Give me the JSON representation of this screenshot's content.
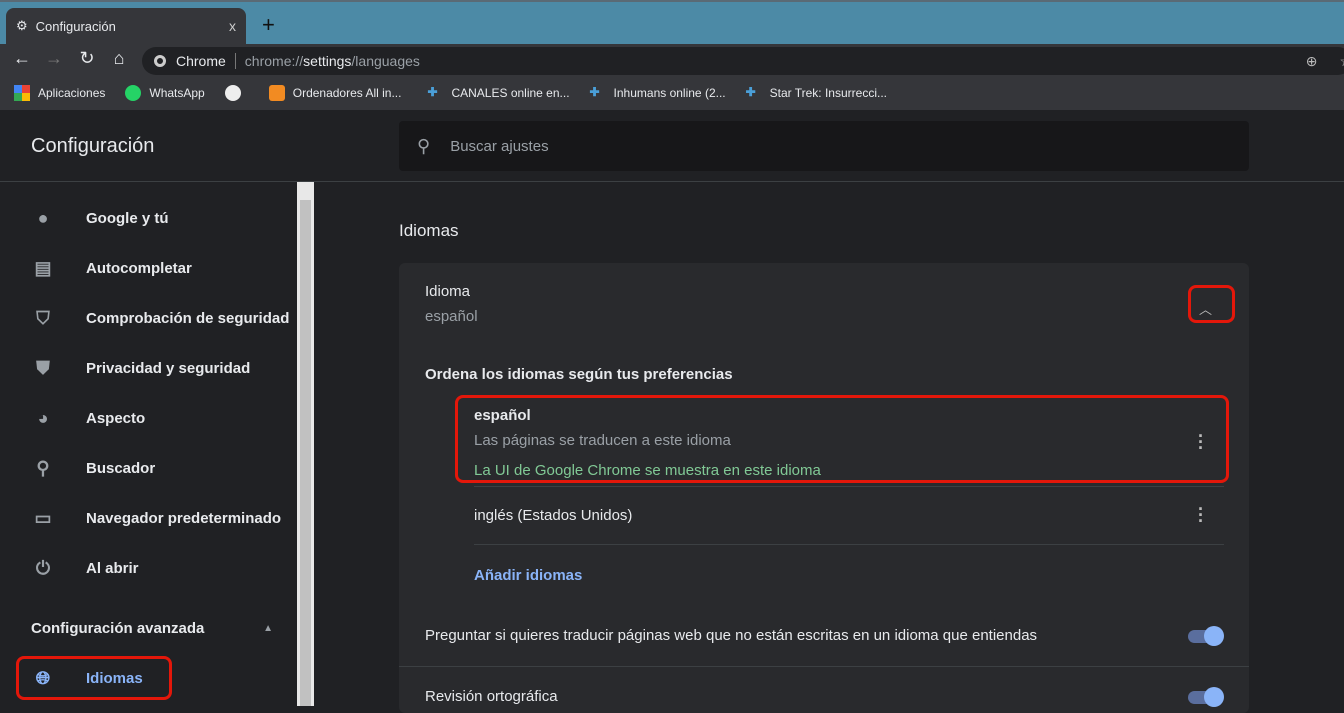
{
  "browser": {
    "tab_title": "Configuración",
    "tab_close": "x",
    "new_tab": "+",
    "omnibox_site": "Chrome",
    "url_prefix": "chrome://",
    "url_host": "settings",
    "url_path": "/languages"
  },
  "bookmarks": [
    {
      "label": "Aplicaciones",
      "icon": "apps-grid-icon"
    },
    {
      "label": "WhatsApp",
      "icon": "whatsapp-icon"
    },
    {
      "label": "",
      "icon": "globe-icon"
    },
    {
      "label": "Ordenadores All in...",
      "icon": "bag-icon"
    },
    {
      "label": "CANALES online en...",
      "icon": "plus-site-icon"
    },
    {
      "label": "Inhumans online (2...",
      "icon": "plus-site-icon"
    },
    {
      "label": "Star Trek: Insurrecci...",
      "icon": "plus-site-icon"
    }
  ],
  "header": {
    "title": "Configuración",
    "search_placeholder": "Buscar ajustes"
  },
  "sidebar": {
    "items": [
      {
        "label": "Google y tú",
        "icon": "person-icon"
      },
      {
        "label": "Autocompletar",
        "icon": "clipboard-icon"
      },
      {
        "label": "Comprobación de seguridad",
        "icon": "shield-check-icon"
      },
      {
        "label": "Privacidad y seguridad",
        "icon": "shield-icon"
      },
      {
        "label": "Aspecto",
        "icon": "palette-icon"
      },
      {
        "label": "Buscador",
        "icon": "search-icon"
      },
      {
        "label": "Navegador predeterminado",
        "icon": "browser-icon"
      },
      {
        "label": "Al abrir",
        "icon": "power-icon"
      }
    ],
    "advanced": "Configuración avanzada",
    "active": {
      "label": "Idiomas",
      "icon": "globe-icon"
    }
  },
  "main": {
    "section_title": "Idiomas",
    "language_label": "Idioma",
    "language_value": "español",
    "order_label": "Ordena los idiomas según tus preferencias",
    "languages": [
      {
        "name": "español",
        "note": "Las páginas se traducen a este idioma",
        "ui_note": "La UI de Google Chrome se muestra en este idioma"
      },
      {
        "name": "inglés (Estados Unidos)"
      }
    ],
    "add_languages": "Añadir idiomas",
    "translate_prompt": "Preguntar si quieres traducir páginas web que no están escritas en un idioma que entiendas",
    "translate_on": true,
    "spellcheck": "Revisión ortográfica",
    "spellcheck_on": true
  }
}
